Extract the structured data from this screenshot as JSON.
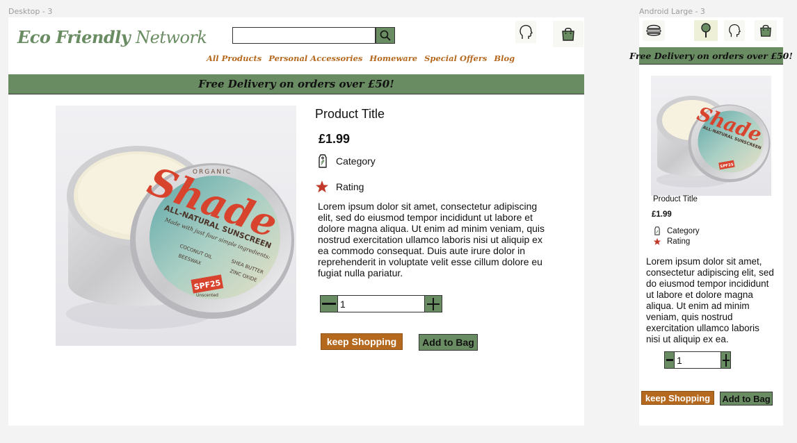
{
  "frames": {
    "desktop_label": "Desktop - 3",
    "android_label": "Android Large - 3"
  },
  "desktop": {
    "brand_bold": "Eco Friendly",
    "brand_light": "Network",
    "search": {
      "value": "",
      "placeholder": ""
    },
    "nav": [
      "All Products",
      "Personal Accessories",
      "Homeware",
      "Special Offers",
      "Blog"
    ],
    "banner": "Free Delivery on orders over £50!",
    "product": {
      "title": "Product Title",
      "price": "£1.99",
      "category": "Category",
      "rating": "Rating",
      "description": "Lorem ipsum dolor sit amet, consectetur adipiscing elit, sed do eiusmod tempor incididunt ut labore et dolore magna aliqua. Ut enim ad minim veniam, quis nostrud exercitation ullamco laboris nisi ut aliquip ex ea commodo consequat. Duis aute irure dolor in reprehenderit in voluptate velit esse cillum dolore eu fugiat nulla pariatur.",
      "quantity": "1"
    },
    "buttons": {
      "keep_shopping": "keep Shopping",
      "add_to_bag": "Add to Bag"
    }
  },
  "android": {
    "banner": "Free Delivery on orders over £50!",
    "product": {
      "title": "Product Title",
      "price": "£1.99",
      "category": "Category",
      "rating": "Rating",
      "description": "Lorem ipsum dolor sit amet, consectetur adipiscing elit, sed do eiusmod tempor incididunt ut labore et dolore magna aliqua. Ut enim ad minim veniam, quis nostrud exercitation ullamco laboris nisi ut aliquip ex ea.",
      "quantity": "1"
    },
    "buttons": {
      "keep_shopping": "keep Shopping",
      "add_to_bag": "Add to Bag"
    }
  },
  "product_image": {
    "brand": "Shade",
    "tagline": "ALL-NATURAL SUNSCREEN",
    "organic": "ORGANIC",
    "sub": "Made with just four simple ingredients:",
    "ingredients": [
      "COCONUT OIL",
      "BEESWAX",
      "SHEA BUTTER",
      "ZINC OXIDE"
    ],
    "spf": "SPF25",
    "unscented": "Unscented"
  },
  "icons": {
    "search": "search-icon",
    "account": "head-profile-icon",
    "bag": "shopping-bag-icon",
    "menu": "hamburger-menu-icon",
    "category": "tag-icon",
    "rating": "star-icon",
    "minus": "minus-icon",
    "plus": "plus-icon"
  },
  "colors": {
    "brand_green": "#6a8c62",
    "accent_orange": "#b4691f",
    "star_red": "#c0392b",
    "canvas": "#f3f3f3"
  }
}
